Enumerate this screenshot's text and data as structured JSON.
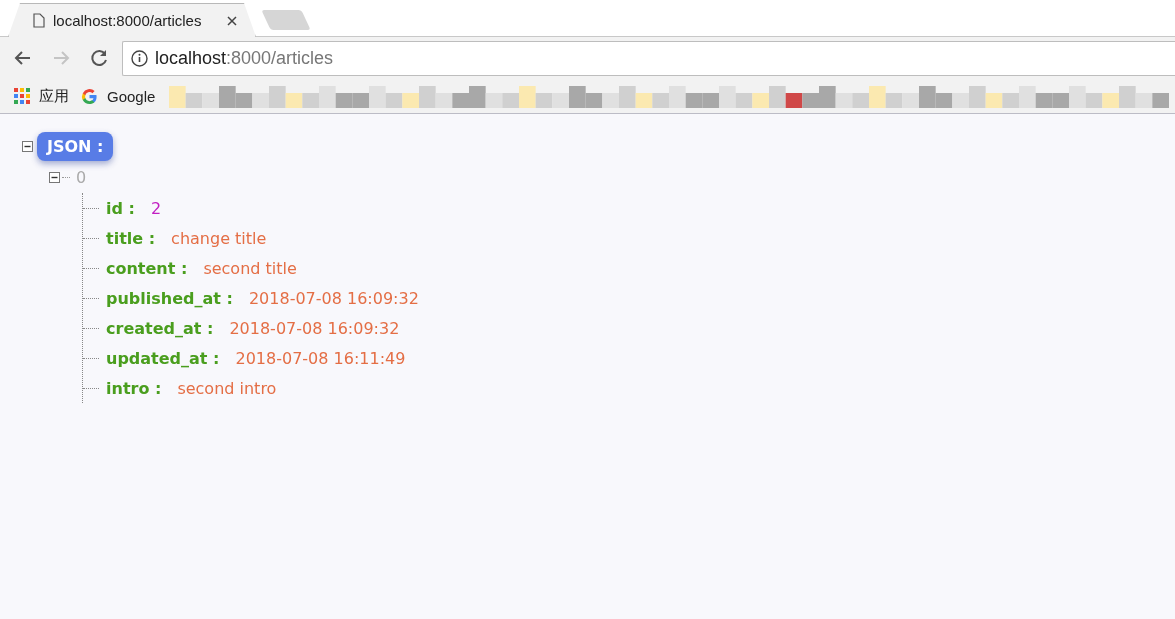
{
  "tab": {
    "title": "localhost:8000/articles"
  },
  "address_bar": {
    "host": "localhost",
    "path": ":8000/articles"
  },
  "bookmarks": [
    {
      "label": "应用",
      "kind": "apps"
    },
    {
      "label": "Google",
      "kind": "google"
    }
  ],
  "tree": {
    "label": "JSON :",
    "expanded": true,
    "children": [
      {
        "label": "0",
        "expanded": true,
        "children": [
          {
            "key": "id :",
            "value": "2",
            "kind": "number"
          },
          {
            "key": "title :",
            "value": "change title",
            "kind": "string"
          },
          {
            "key": "content :",
            "value": "second title",
            "kind": "string"
          },
          {
            "key": "published_at :",
            "value": "2018-07-08 16:09:32",
            "kind": "string"
          },
          {
            "key": "created_at :",
            "value": "2018-07-08 16:09:32",
            "kind": "string"
          },
          {
            "key": "updated_at :",
            "value": "2018-07-08 16:11:49",
            "kind": "string"
          },
          {
            "key": "intro :",
            "value": "second intro",
            "kind": "string"
          }
        ]
      }
    ]
  }
}
